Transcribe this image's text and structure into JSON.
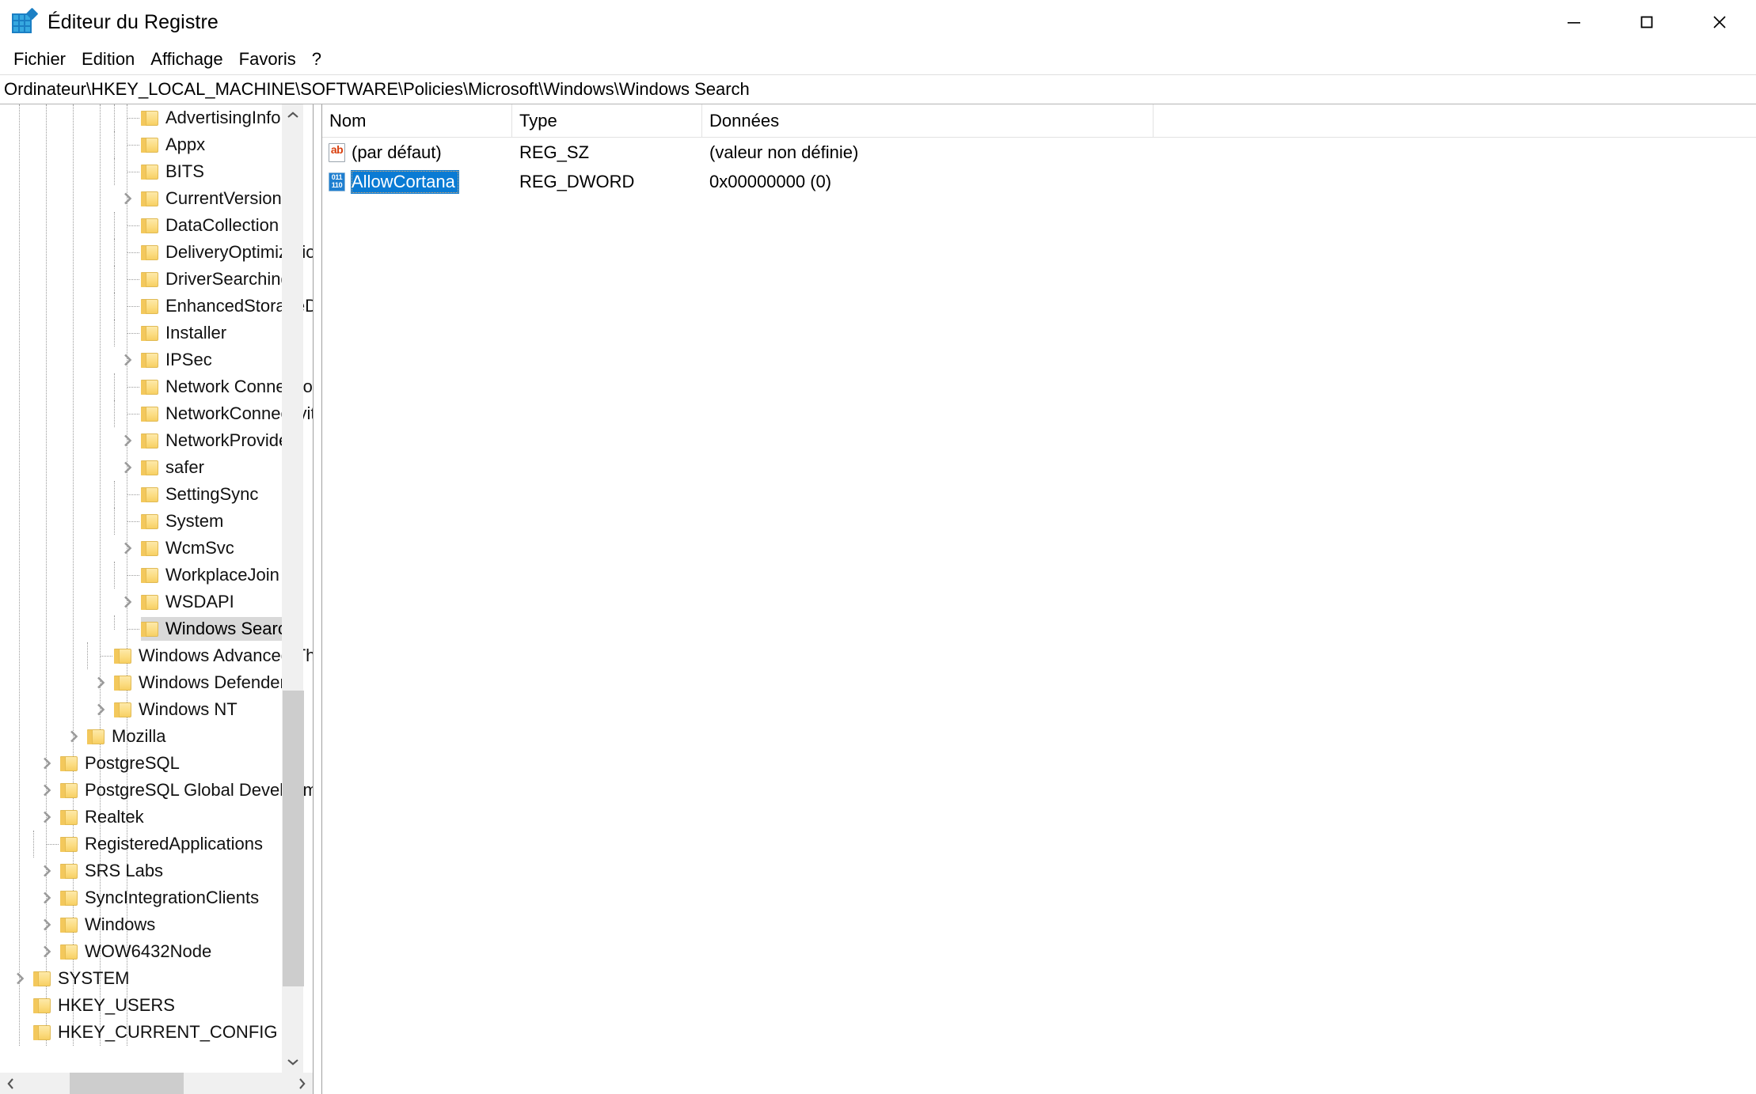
{
  "window": {
    "title": "Éditeur du Registre",
    "icon": "registry-editor-icon",
    "controls": {
      "minimize": "minimize-icon",
      "maximize": "maximize-icon",
      "close": "close-icon"
    }
  },
  "menu": {
    "items": [
      {
        "label": "Fichier"
      },
      {
        "label": "Edition"
      },
      {
        "label": "Affichage"
      },
      {
        "label": "Favoris"
      },
      {
        "label": "?"
      }
    ]
  },
  "address": {
    "path": "Ordinateur\\HKEY_LOCAL_MACHINE\\SOFTWARE\\Policies\\Microsoft\\Windows\\Windows Search"
  },
  "tree": {
    "items": [
      {
        "label": "AdvertisingInfo",
        "indent": 4,
        "expander": false,
        "connector": "tee",
        "selected": false
      },
      {
        "label": "Appx",
        "indent": 4,
        "expander": false,
        "connector": "tee",
        "selected": false
      },
      {
        "label": "BITS",
        "indent": 4,
        "expander": false,
        "connector": "tee",
        "selected": false
      },
      {
        "label": "CurrentVersion",
        "indent": 4,
        "expander": true,
        "connector": "none",
        "selected": false
      },
      {
        "label": "DataCollection",
        "indent": 4,
        "expander": false,
        "connector": "tee",
        "selected": false
      },
      {
        "label": "DeliveryOptimization",
        "indent": 4,
        "expander": false,
        "connector": "tee",
        "selected": false
      },
      {
        "label": "DriverSearching",
        "indent": 4,
        "expander": false,
        "connector": "tee",
        "selected": false
      },
      {
        "label": "EnhancedStorageDevices",
        "indent": 4,
        "expander": false,
        "connector": "tee",
        "selected": false
      },
      {
        "label": "Installer",
        "indent": 4,
        "expander": false,
        "connector": "tee",
        "selected": false
      },
      {
        "label": "IPSec",
        "indent": 4,
        "expander": true,
        "connector": "none",
        "selected": false
      },
      {
        "label": "Network Connections",
        "indent": 4,
        "expander": false,
        "connector": "tee",
        "selected": false
      },
      {
        "label": "NetworkConnectivityStatusIndicator",
        "indent": 4,
        "expander": false,
        "connector": "tee",
        "selected": false
      },
      {
        "label": "NetworkProvider",
        "indent": 4,
        "expander": true,
        "connector": "none",
        "selected": false
      },
      {
        "label": "safer",
        "indent": 4,
        "expander": true,
        "connector": "none",
        "selected": false
      },
      {
        "label": "SettingSync",
        "indent": 4,
        "expander": false,
        "connector": "tee",
        "selected": false
      },
      {
        "label": "System",
        "indent": 4,
        "expander": false,
        "connector": "tee",
        "selected": false
      },
      {
        "label": "WcmSvc",
        "indent": 4,
        "expander": true,
        "connector": "none",
        "selected": false
      },
      {
        "label": "WorkplaceJoin",
        "indent": 4,
        "expander": false,
        "connector": "tee",
        "selected": false
      },
      {
        "label": "WSDAPI",
        "indent": 4,
        "expander": true,
        "connector": "none",
        "selected": false
      },
      {
        "label": "Windows Search",
        "indent": 4,
        "expander": false,
        "connector": "elbow",
        "selected": true
      },
      {
        "label": "Windows Advanced Threat Protection",
        "indent": 3,
        "expander": false,
        "connector": "tee",
        "selected": false
      },
      {
        "label": "Windows Defender",
        "indent": 3,
        "expander": true,
        "connector": "none",
        "selected": false
      },
      {
        "label": "Windows NT",
        "indent": 3,
        "expander": true,
        "connector": "none",
        "selected": false
      },
      {
        "label": "Mozilla",
        "indent": 2,
        "expander": true,
        "connector": "none",
        "selected": false
      },
      {
        "label": "PostgreSQL",
        "indent": 1,
        "expander": true,
        "connector": "none",
        "selected": false
      },
      {
        "label": "PostgreSQL Global Development Group",
        "indent": 1,
        "expander": true,
        "connector": "none",
        "selected": false
      },
      {
        "label": "Realtek",
        "indent": 1,
        "expander": true,
        "connector": "none",
        "selected": false
      },
      {
        "label": "RegisteredApplications",
        "indent": 1,
        "expander": false,
        "connector": "tee",
        "selected": false
      },
      {
        "label": "SRS Labs",
        "indent": 1,
        "expander": true,
        "connector": "none",
        "selected": false
      },
      {
        "label": "SyncIntegrationClients",
        "indent": 1,
        "expander": true,
        "connector": "none",
        "selected": false
      },
      {
        "label": "Windows",
        "indent": 1,
        "expander": true,
        "connector": "none",
        "selected": false
      },
      {
        "label": "WOW6432Node",
        "indent": 1,
        "expander": true,
        "connector": "none",
        "selected": false
      },
      {
        "label": "SYSTEM",
        "indent": 0,
        "expander": true,
        "connector": "none",
        "selected": false
      },
      {
        "label": "HKEY_USERS",
        "indent": -1,
        "expander": false,
        "connector": "none",
        "selected": false
      },
      {
        "label": "HKEY_CURRENT_CONFIG",
        "indent": -1,
        "expander": false,
        "connector": "none",
        "selected": false
      }
    ],
    "guide_levels": [
      0,
      1,
      2,
      3,
      4
    ],
    "vscroll": {
      "thumb_top_pct": 61,
      "thumb_height_pct": 32
    },
    "hscroll": {
      "thumb_left_pct": 18,
      "thumb_width_pct": 42
    }
  },
  "list": {
    "columns": [
      {
        "label": "Nom"
      },
      {
        "label": "Type"
      },
      {
        "label": "Données"
      }
    ],
    "rows": [
      {
        "icon": "string-value-icon",
        "name": "(par défaut)",
        "type": "REG_SZ",
        "data": "(valeur non définie)",
        "selected": false
      },
      {
        "icon": "dword-value-icon",
        "name": "AllowCortana",
        "type": "REG_DWORD",
        "data": "0x00000000 (0)",
        "selected": true
      }
    ]
  },
  "colors": {
    "selection_blue": "#0a7bd4",
    "tree_selection_gray": "#d9d9d9",
    "folder_yellow": "#fcdd83",
    "scrollbar_thumb": "#cdcdcd",
    "title_icon_blue": "#1b7fc4"
  }
}
